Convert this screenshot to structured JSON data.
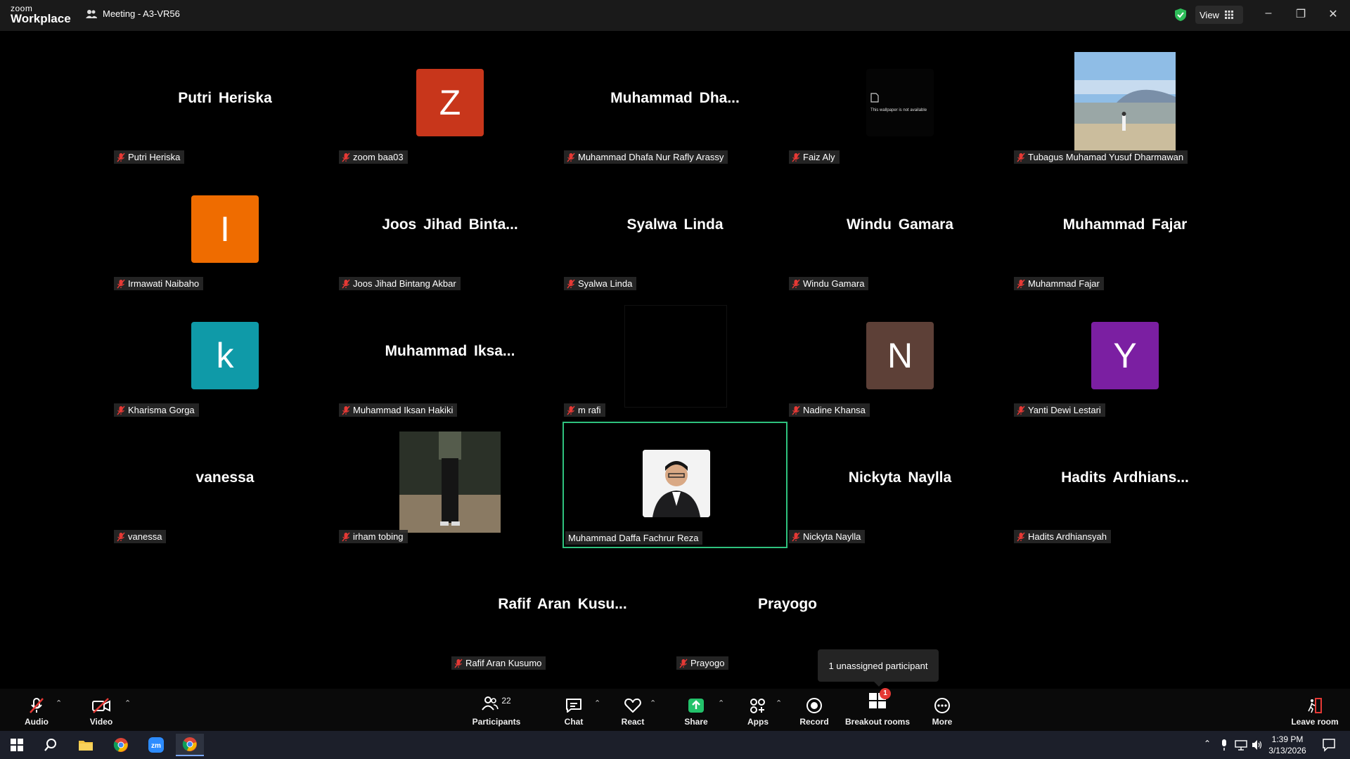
{
  "titlebar": {
    "brand_top": "zoom",
    "brand_bottom": "Workplace",
    "meeting_title": "Meeting - A3-VR56",
    "view_label": "View"
  },
  "participants": [
    {
      "display": "Putri Heriska",
      "label": "Putri Heriska",
      "type": "name"
    },
    {
      "display": "Z",
      "label": "zoom baa03",
      "type": "avatar",
      "color": "#c8361b"
    },
    {
      "display": "Muhammad Dha...",
      "label": "Muhammad Dhafa Nur Rafly Arassy",
      "type": "name"
    },
    {
      "display": "This wallpaper is not available",
      "label": "Faiz Aly",
      "type": "wallpaper"
    },
    {
      "display": "",
      "label": "Tubagus Muhamad Yusuf Dharmawan",
      "type": "photo-beach"
    },
    {
      "display": "I",
      "label": "Irmawati Naibaho",
      "type": "avatar",
      "color": "#ef6c00"
    },
    {
      "display": "Joos Jihad Binta...",
      "label": "Joos Jihad Bintang Akbar",
      "type": "name"
    },
    {
      "display": "Syalwa Linda",
      "label": "Syalwa Linda",
      "type": "name"
    },
    {
      "display": "Windu Gamara",
      "label": "Windu Gamara",
      "type": "name"
    },
    {
      "display": "Muhammad Fajar",
      "label": "Muhammad Fajar",
      "type": "name"
    },
    {
      "display": "k",
      "label": "Kharisma Gorga",
      "type": "avatar",
      "color": "#0f9aa8"
    },
    {
      "display": "Muhammad Iksa...",
      "label": "Muhammad Iksan Hakiki",
      "type": "name"
    },
    {
      "display": "",
      "label": "m rafi",
      "type": "black"
    },
    {
      "display": "N",
      "label": "Nadine Khansa",
      "type": "avatar",
      "color": "#5d4037"
    },
    {
      "display": "Y",
      "label": "Yanti Dewi Lestari",
      "type": "avatar",
      "color": "#7b1fa2"
    },
    {
      "display": "vanessa",
      "label": "vanessa",
      "type": "name"
    },
    {
      "display": "",
      "label": "irham tobing",
      "type": "photo-standing"
    },
    {
      "display": "",
      "label": "Muhammad Daffa Fachrur Reza",
      "type": "photo-portrait",
      "active": true
    },
    {
      "display": "Nickyta Naylla",
      "label": "Nickyta Naylla",
      "type": "name"
    },
    {
      "display": "Hadits Ardhians...",
      "label": "Hadits Ardhiansyah",
      "type": "name"
    },
    {
      "display": "Rafif Aran Kusu...",
      "label": "Rafif Aran Kusumo",
      "type": "name"
    },
    {
      "display": "Prayogo",
      "label": "Prayogo",
      "type": "name"
    }
  ],
  "tooltip": "1 unassigned participant",
  "toolbar": {
    "audio": "Audio",
    "video": "Video",
    "participants": "Participants",
    "participants_count": "22",
    "chat": "Chat",
    "react": "React",
    "share": "Share",
    "apps": "Apps",
    "record": "Record",
    "breakout": "Breakout rooms",
    "breakout_badge": "1",
    "more": "More",
    "leave": "Leave room"
  },
  "taskbar": {
    "time": "1:39 PM",
    "date": "3/13/2026"
  },
  "colors": {
    "active_border": "#2ec27e",
    "share_green": "#23c26b",
    "muted_red": "#e53935"
  }
}
